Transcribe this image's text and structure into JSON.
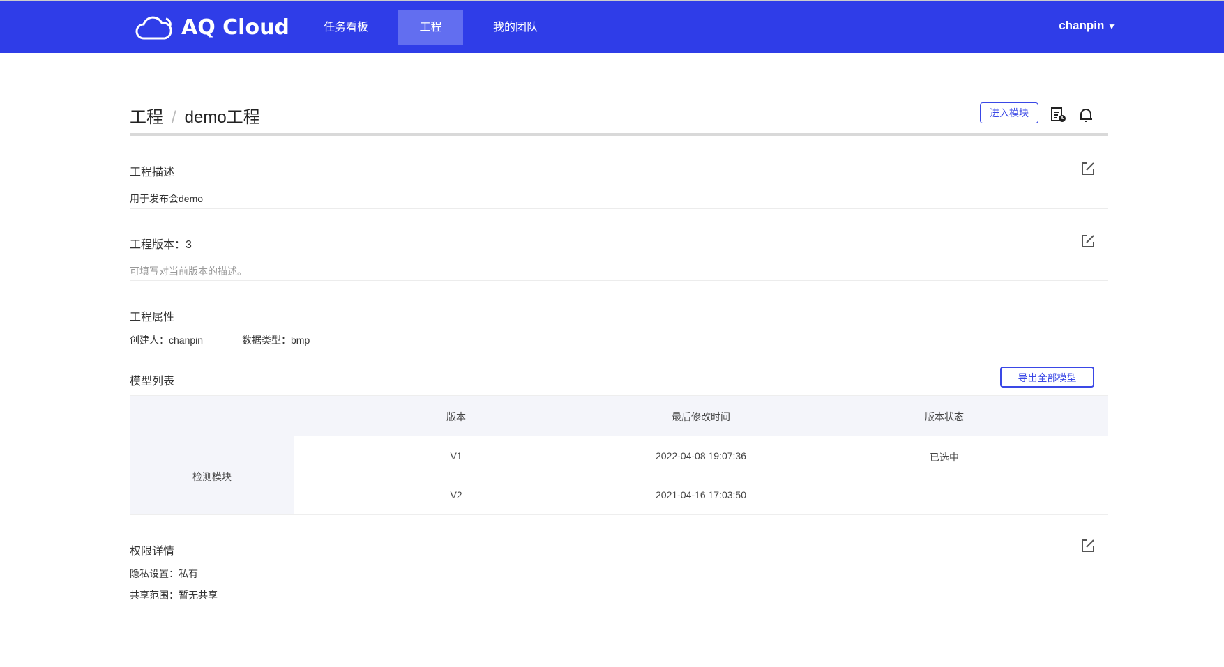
{
  "nav": {
    "brand": "AQ Cloud",
    "items": [
      {
        "label": "任务看板"
      },
      {
        "label": "工程",
        "active": true
      },
      {
        "label": "我的团队"
      }
    ],
    "user": "chanpin"
  },
  "breadcrumb": {
    "root": "工程",
    "sep": "/",
    "current": "demo工程"
  },
  "toolbar": {
    "enter_module": "进入模块"
  },
  "description": {
    "title": "工程描述",
    "text": "用于发布会demo"
  },
  "version": {
    "title": "工程版本：3",
    "hint": "可填写对当前版本的描述。"
  },
  "attributes": {
    "title": "工程属性",
    "creator": "创建人：chanpin",
    "data_type": "数据类型：bmp"
  },
  "models": {
    "title": "模型列表",
    "export": "导出全部模型",
    "columns": [
      "版本",
      "最后修改时间",
      "版本状态"
    ],
    "group": "检测模块",
    "rows": [
      {
        "version": "V1",
        "time": "2022-04-08 19:07:36",
        "status": "已选中"
      },
      {
        "version": "V2",
        "time": "2021-04-16 17:03:50",
        "status": ""
      }
    ]
  },
  "permissions": {
    "title": "权限详情",
    "privacy": "隐私设置：私有",
    "share": "共享范围：暂无共享"
  },
  "colors": {
    "nav": "#2f3de8",
    "active": "#626ef0",
    "accent": "#3a48e6"
  }
}
